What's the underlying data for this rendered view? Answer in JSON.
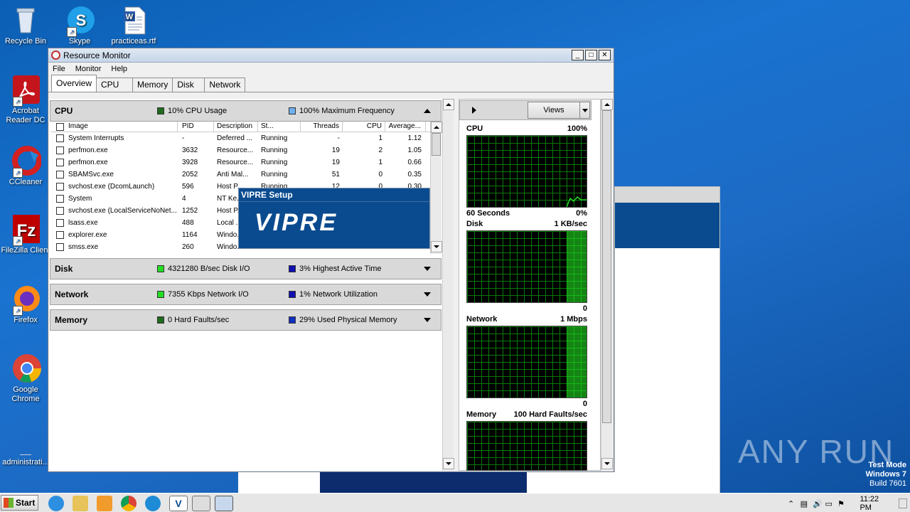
{
  "desktop": {
    "icons": [
      {
        "label": "Recycle Bin"
      },
      {
        "label": "Skype"
      },
      {
        "label": "practiceas.rtf"
      },
      {
        "label": "Acrobat Reader DC"
      },
      {
        "label": "CCleaner"
      },
      {
        "label": "FileZilla Client"
      },
      {
        "label": "Firefox"
      },
      {
        "label": "Google Chrome"
      },
      {
        "label": "administrati..."
      }
    ],
    "watermark": {
      "brand": "ANY RUN",
      "line1": "Test Mode",
      "line2": "Windows 7",
      "line3": "Build 7601"
    }
  },
  "resmon": {
    "title": "Resource Monitor",
    "menu": [
      "File",
      "Monitor",
      "Help"
    ],
    "tabs": [
      "Overview",
      "CPU",
      "Memory",
      "Disk",
      "Network"
    ],
    "active_tab": "Overview",
    "cpu_section": {
      "title": "CPU",
      "metric1": "10% CPU Usage",
      "metric1_color": "#1e6b1e",
      "metric2": "100% Maximum Frequency",
      "metric2_color": "#6fb0f0",
      "columns": [
        "Image",
        "PID",
        "Description",
        "St...",
        "Threads",
        "CPU",
        "Average..."
      ],
      "rows": [
        {
          "image": "System Interrupts",
          "pid": "-",
          "desc": "Deferred ...",
          "status": "Running",
          "threads": "-",
          "cpu": "1",
          "avg": "1.12"
        },
        {
          "image": "perfmon.exe",
          "pid": "3632",
          "desc": "Resource...",
          "status": "Running",
          "threads": "19",
          "cpu": "2",
          "avg": "1.05"
        },
        {
          "image": "perfmon.exe",
          "pid": "3928",
          "desc": "Resource...",
          "status": "Running",
          "threads": "19",
          "cpu": "1",
          "avg": "0.66"
        },
        {
          "image": "SBAMSvc.exe",
          "pid": "2052",
          "desc": "Anti Mal...",
          "status": "Running",
          "threads": "51",
          "cpu": "0",
          "avg": "0.35"
        },
        {
          "image": "svchost.exe (DcomLaunch)",
          "pid": "596",
          "desc": "Host P...",
          "status": "Running",
          "threads": "12",
          "cpu": "0",
          "avg": "0.30"
        },
        {
          "image": "System",
          "pid": "4",
          "desc": "NT Ke...",
          "status": "",
          "threads": "",
          "cpu": "",
          "avg": ""
        },
        {
          "image": "svchost.exe (LocalServiceNoNet...",
          "pid": "1252",
          "desc": "Host P...",
          "status": "",
          "threads": "",
          "cpu": "",
          "avg": ""
        },
        {
          "image": "lsass.exe",
          "pid": "488",
          "desc": "Local ...",
          "status": "",
          "threads": "",
          "cpu": "",
          "avg": ""
        },
        {
          "image": "explorer.exe",
          "pid": "1164",
          "desc": "Windo...",
          "status": "",
          "threads": "",
          "cpu": "",
          "avg": ""
        },
        {
          "image": "smss.exe",
          "pid": "260",
          "desc": "Windo...",
          "status": "",
          "threads": "",
          "cpu": "",
          "avg": ""
        }
      ]
    },
    "disk_section": {
      "title": "Disk",
      "metric1": "4321280 B/sec Disk I/O",
      "metric1_color": "#22dd22",
      "metric2": "3% Highest Active Time",
      "metric2_color": "#1010b0"
    },
    "network_section": {
      "title": "Network",
      "metric1": "7355 Kbps Network I/O",
      "metric1_color": "#22dd22",
      "metric2": "1% Network Utilization",
      "metric2_color": "#1010b0"
    },
    "memory_section": {
      "title": "Memory",
      "metric1": "0 Hard Faults/sec",
      "metric1_color": "#1e6b1e",
      "metric2": "29% Used Physical Memory",
      "metric2_color": "#1030c0"
    },
    "right_pane": {
      "views_label": "Views",
      "graphs": [
        {
          "name": "CPU",
          "max": "100%",
          "footer_left": "60 Seconds",
          "footer_right": "0%"
        },
        {
          "name": "Disk",
          "max": "1 KB/sec",
          "footer_left": "",
          "footer_right": "0"
        },
        {
          "name": "Network",
          "max": "1 Mbps",
          "footer_left": "",
          "footer_right": "0"
        },
        {
          "name": "Memory",
          "max": "100 Hard Faults/sec",
          "footer_left": "",
          "footer_right": ""
        }
      ]
    }
  },
  "vipre_popup": {
    "title": "VIPRE Setup",
    "logo": "VIPRE"
  },
  "taskbar": {
    "start_label": "Start",
    "clock": "11:22 PM"
  }
}
